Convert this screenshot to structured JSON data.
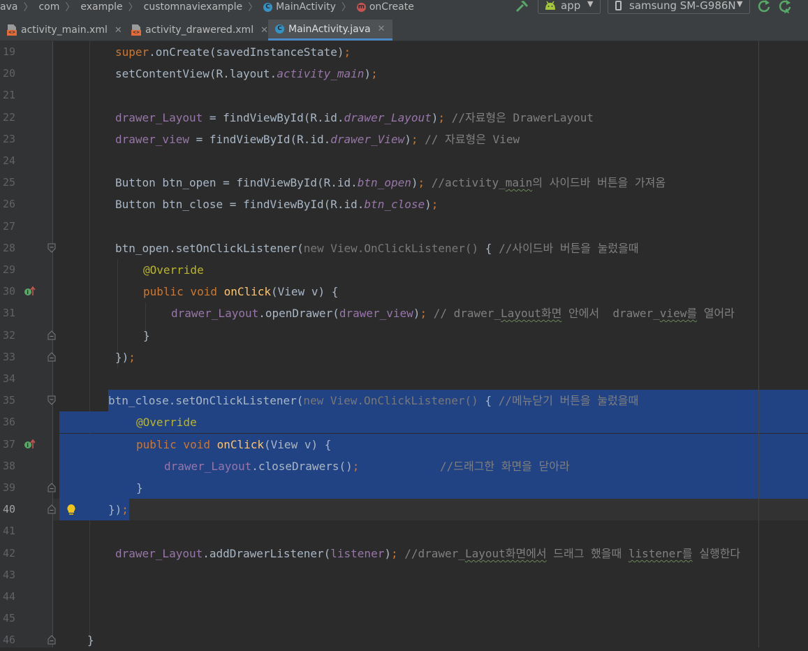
{
  "breadcrumbs": [
    {
      "label": "ava",
      "icon": null
    },
    {
      "label": "com",
      "icon": null
    },
    {
      "label": "example",
      "icon": null
    },
    {
      "label": "customnaviexample",
      "icon": null
    },
    {
      "label": "MainActivity",
      "icon": "class-icon"
    },
    {
      "label": "onCreate",
      "icon": "method-icon"
    }
  ],
  "toolbar": {
    "run_config": "app",
    "device": "samsung SM-G986N",
    "icons": [
      "hammer-icon",
      "android-icon",
      "apply-changes-icon",
      "apply-code-changes-icon"
    ]
  },
  "tabs": [
    {
      "label": "activity_main.xml",
      "icon": "xml-file-icon",
      "active": false
    },
    {
      "label": "activity_drawered.xml",
      "icon": "xml-file-icon",
      "active": false
    },
    {
      "label": "MainActivity.java",
      "icon": "class-icon",
      "active": true
    }
  ],
  "editor": {
    "current_line": "40",
    "colors": {
      "selection": "#214283",
      "keyword": "#cc7832",
      "field": "#9876aa",
      "comment": "#808080",
      "annotation": "#bbb529",
      "method": "#ffc66d"
    },
    "lines": [
      {
        "n": "19",
        "tokens": [
          [
            "kw",
            "super"
          ],
          [
            "plain",
            ".onCreate(savedInstanceState)"
          ],
          [
            "kw",
            ";"
          ]
        ]
      },
      {
        "n": "20",
        "tokens": [
          [
            "plain",
            "setContentView(R.layout."
          ],
          [
            "ital",
            "activity_main"
          ],
          [
            "plain",
            ")"
          ],
          [
            "kw",
            ";"
          ]
        ]
      },
      {
        "n": "21",
        "tokens": []
      },
      {
        "n": "22",
        "tokens": [
          [
            "fld",
            "drawer_Layout"
          ],
          [
            "plain",
            " = findViewById(R.id."
          ],
          [
            "ital",
            "drawer_Layout"
          ],
          [
            "plain",
            ")"
          ],
          [
            "kw",
            ";"
          ],
          [
            "cmt",
            " //자료형은 DrawerLayout"
          ]
        ]
      },
      {
        "n": "23",
        "tokens": [
          [
            "fld",
            "drawer_view"
          ],
          [
            "plain",
            " = findViewById(R.id."
          ],
          [
            "ital",
            "drawer_View"
          ],
          [
            "plain",
            ")"
          ],
          [
            "kw",
            ";"
          ],
          [
            "cmt",
            " // 자료형은 View"
          ]
        ]
      },
      {
        "n": "24",
        "tokens": []
      },
      {
        "n": "25",
        "tokens": [
          [
            "plain",
            "Button btn_open = findViewById(R.id."
          ],
          [
            "ital",
            "btn_open"
          ],
          [
            "plain",
            ")"
          ],
          [
            "kw",
            ";"
          ],
          [
            "cmt",
            " //activity_"
          ],
          [
            "cmtw",
            "main"
          ],
          [
            "cmt",
            "의 사이드바 버튼을 가져옴"
          ]
        ]
      },
      {
        "n": "26",
        "tokens": [
          [
            "plain",
            "Button btn_close = findViewById(R.id."
          ],
          [
            "ital",
            "btn_close"
          ],
          [
            "plain",
            ")"
          ],
          [
            "kw",
            ";"
          ]
        ]
      },
      {
        "n": "27",
        "tokens": []
      },
      {
        "n": "28",
        "tokens": [
          [
            "plain",
            "btn_open.setOnClickListener("
          ],
          [
            "gray",
            "new View.OnClickListener()"
          ],
          [
            "plain",
            " { "
          ],
          [
            "cmt",
            "//사이드바 버튼을 눌렀을때"
          ]
        ]
      },
      {
        "n": "29",
        "tokens": [
          [
            "ann",
            "@Override"
          ]
        ]
      },
      {
        "n": "30",
        "tokens": [
          [
            "kw",
            "public void "
          ],
          [
            "mth",
            "onClick"
          ],
          [
            "plain",
            "(View v) {"
          ]
        ]
      },
      {
        "n": "31",
        "tokens": [
          [
            "fld",
            "drawer_Layout"
          ],
          [
            "plain",
            ".openDrawer("
          ],
          [
            "fld",
            "drawer_view"
          ],
          [
            "plain",
            ")"
          ],
          [
            "kw",
            ";"
          ],
          [
            "cmt",
            " // drawer_"
          ],
          [
            "cmtw",
            "Layout화면"
          ],
          [
            "cmt",
            " 안에서  drawer_"
          ],
          [
            "cmtw",
            "view를"
          ],
          [
            "cmt",
            " 열어라"
          ]
        ]
      },
      {
        "n": "32",
        "tokens": [
          [
            "plain",
            "}"
          ]
        ]
      },
      {
        "n": "33",
        "tokens": [
          [
            "plain",
            "})"
          ],
          [
            "kw",
            ";"
          ]
        ]
      },
      {
        "n": "34",
        "tokens": []
      },
      {
        "n": "35",
        "tokens": [
          [
            "plain",
            "btn_close.setOnClickListener("
          ],
          [
            "gray",
            "new View.OnClickListener()"
          ],
          [
            "plain",
            " { "
          ],
          [
            "cmt",
            "//메뉴닫기 버튼을 눌렀을때"
          ]
        ]
      },
      {
        "n": "36",
        "tokens": [
          [
            "ann",
            "@Override"
          ]
        ]
      },
      {
        "n": "37",
        "tokens": [
          [
            "kw",
            "public void "
          ],
          [
            "mth",
            "onClick"
          ],
          [
            "plain",
            "(View v) {"
          ]
        ]
      },
      {
        "n": "38",
        "tokens": [
          [
            "fld",
            "drawer_Layout"
          ],
          [
            "plain",
            ".closeDrawers()"
          ],
          [
            "kw",
            ";"
          ],
          [
            "cmt",
            "            //드래그한 화면을 닫아라"
          ]
        ]
      },
      {
        "n": "39",
        "tokens": [
          [
            "plain",
            "}"
          ]
        ]
      },
      {
        "n": "40",
        "tokens": [
          [
            "plain",
            "})"
          ],
          [
            "kw",
            ";"
          ]
        ]
      },
      {
        "n": "41",
        "tokens": []
      },
      {
        "n": "42",
        "tokens": [
          [
            "fld",
            "drawer_Layout"
          ],
          [
            "plain",
            ".addDrawerListener("
          ],
          [
            "fld",
            "listener"
          ],
          [
            "plain",
            ")"
          ],
          [
            "kw",
            ";"
          ],
          [
            "cmt",
            " //drawer_"
          ],
          [
            "cmtw",
            "Layout화면에서"
          ],
          [
            "cmt",
            " 드래그 했을때 "
          ],
          [
            "cmtw",
            "listener를"
          ],
          [
            "cmt",
            " 실행한다"
          ]
        ]
      },
      {
        "n": "43",
        "tokens": []
      },
      {
        "n": "44",
        "tokens": []
      },
      {
        "n": "45",
        "tokens": []
      },
      {
        "n": "46",
        "tokens": [
          [
            "plain",
            "}"
          ]
        ]
      }
    ]
  }
}
